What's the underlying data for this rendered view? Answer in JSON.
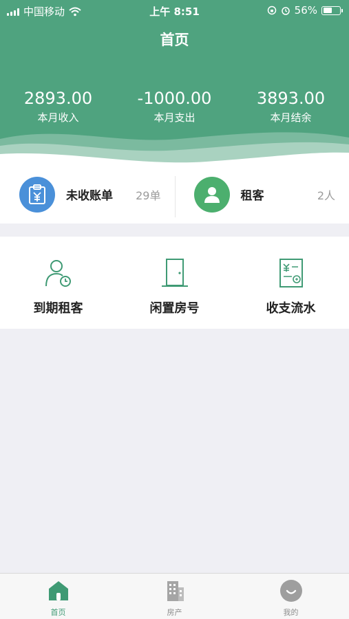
{
  "status_bar": {
    "carrier": "中国移动",
    "time": "上午 8:51",
    "battery": "56%",
    "battery_level": 0.56
  },
  "header": {
    "title": "首页",
    "background_color": "#4fa37f",
    "stats": [
      {
        "value": "2893.00",
        "label": "本月收入"
      },
      {
        "value": "-1000.00",
        "label": "本月支出"
      },
      {
        "value": "3893.00",
        "label": "本月结余"
      }
    ]
  },
  "summary": {
    "items": [
      {
        "label": "未收账单",
        "count": "29单",
        "icon": "bill-clipboard-icon",
        "icon_color": "#4a90d9"
      },
      {
        "label": "租客",
        "count": "2人",
        "icon": "tenant-avatar-icon",
        "icon_color": "#4caf6e"
      }
    ]
  },
  "shortcuts": [
    {
      "label": "到期租客",
      "icon": "expiring-tenant-icon"
    },
    {
      "label": "闲置房号",
      "icon": "vacant-door-icon"
    },
    {
      "label": "收支流水",
      "icon": "ledger-icon"
    }
  ],
  "tabbar": {
    "active_color": "#3f9a74",
    "tabs": [
      {
        "label": "首页",
        "icon": "home-icon",
        "active": true
      },
      {
        "label": "房产",
        "icon": "building-icon",
        "active": false
      },
      {
        "label": "我的",
        "icon": "profile-icon",
        "active": false
      }
    ]
  }
}
